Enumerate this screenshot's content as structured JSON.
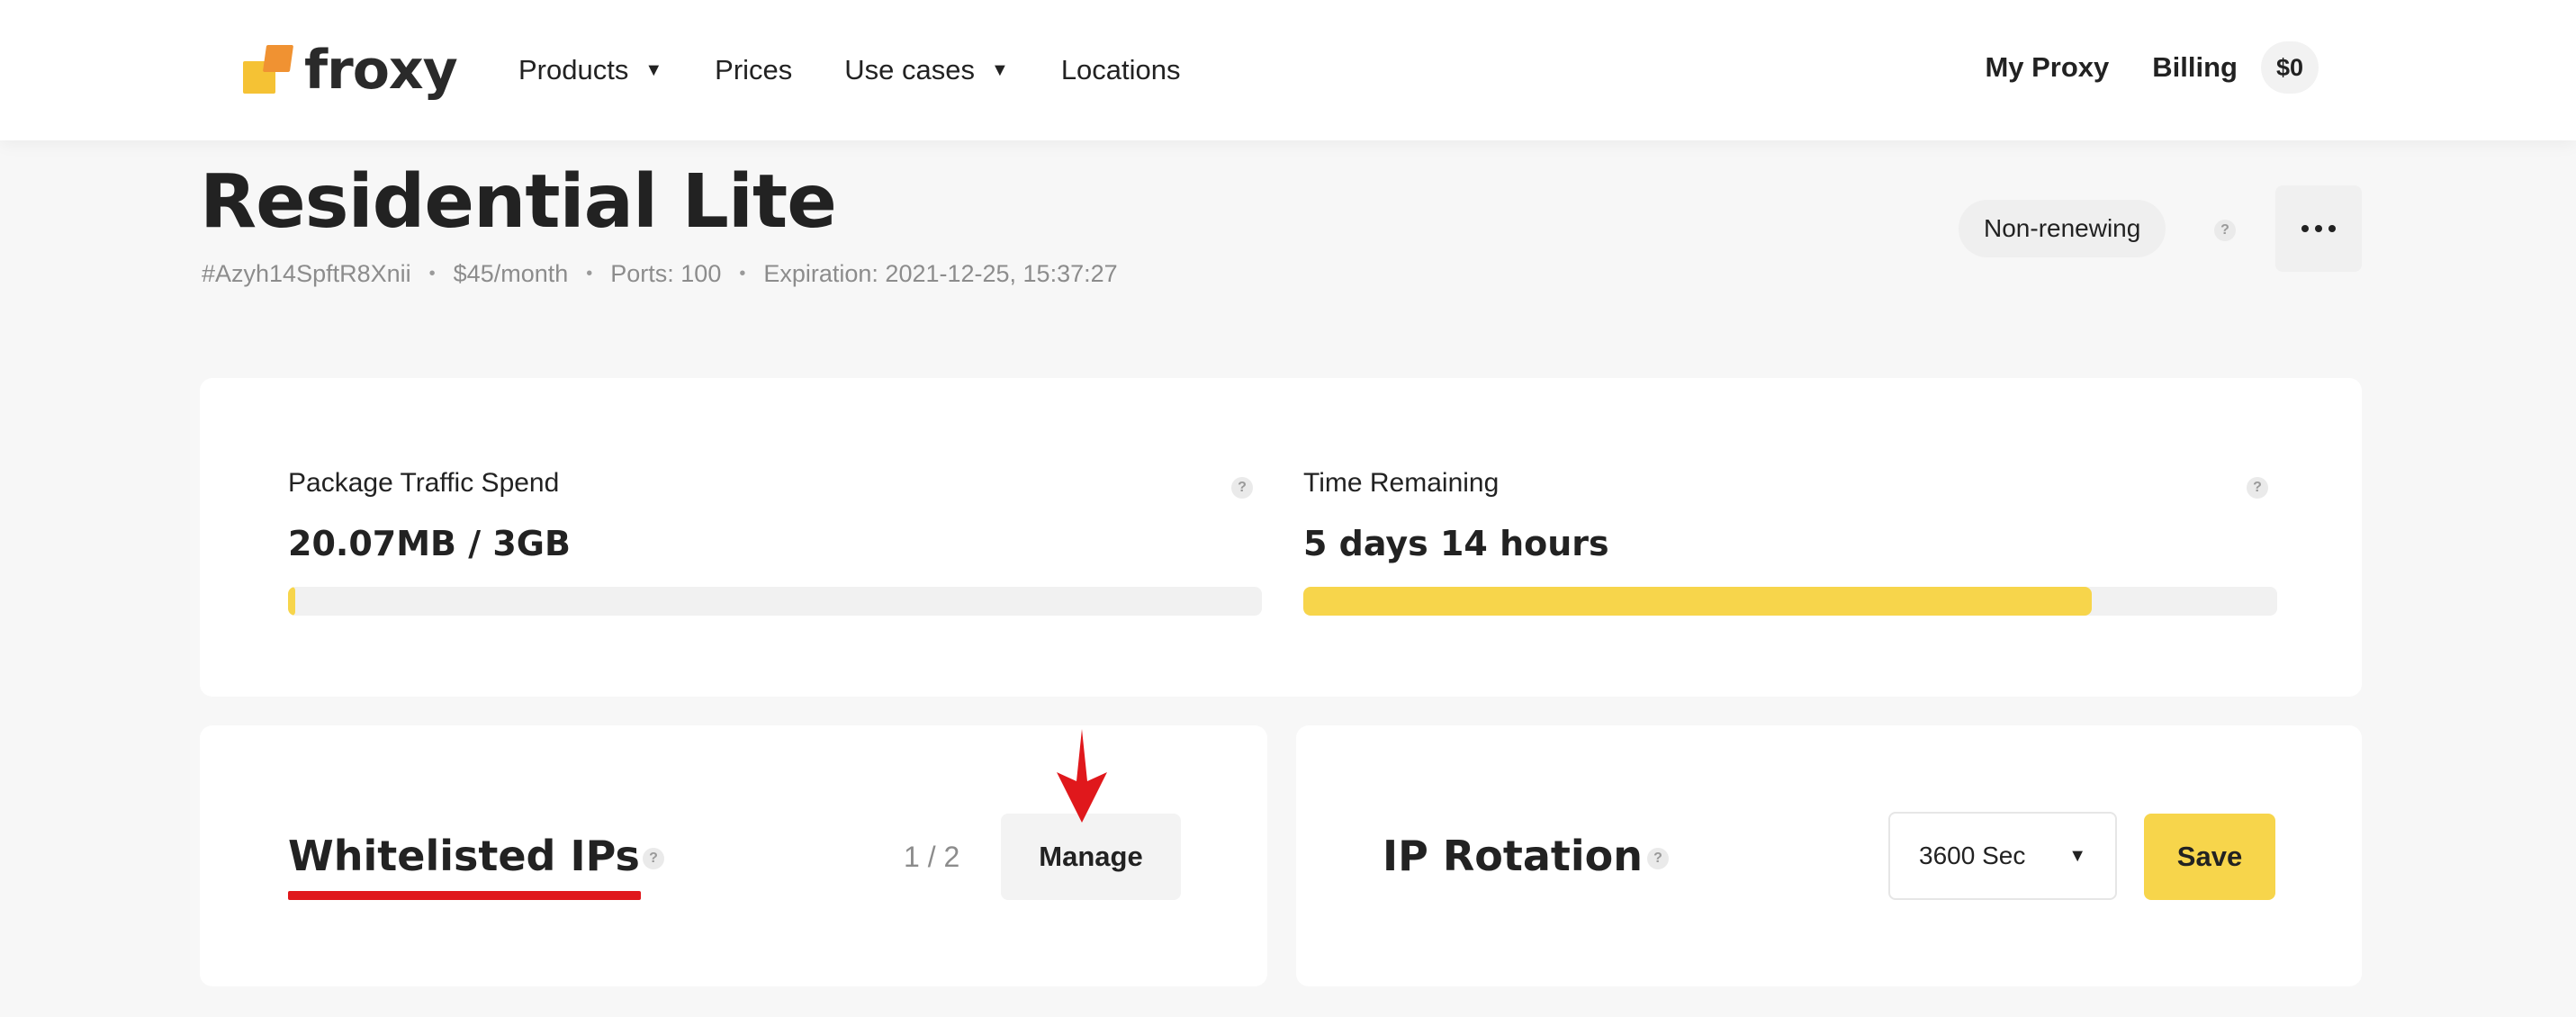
{
  "brand": {
    "name": "froxy"
  },
  "nav": {
    "items": [
      {
        "label": "Products",
        "has_dropdown": true
      },
      {
        "label": "Prices",
        "has_dropdown": false
      },
      {
        "label": "Use cases",
        "has_dropdown": true
      },
      {
        "label": "Locations",
        "has_dropdown": false
      }
    ]
  },
  "header_right": {
    "my_proxy": "My Proxy",
    "billing": "Billing",
    "balance": "$0"
  },
  "plan": {
    "title": "Residential Lite",
    "id": "#Azyh14SpftR8Xnii",
    "price": "$45/month",
    "ports": "Ports: 100",
    "expiration": "Expiration: 2021-12-25, 15:37:27",
    "renewal_status": "Non-renewing"
  },
  "stats": {
    "traffic": {
      "label": "Package Traffic Spend",
      "value": "20.07MB / 3GB",
      "progress_percent": 0.7
    },
    "time": {
      "label": "Time Remaining",
      "value": "5 days 14 hours",
      "progress_percent": 81
    }
  },
  "whitelist": {
    "title": "Whitelisted IPs",
    "count": "1 / 2",
    "manage_label": "Manage"
  },
  "rotation": {
    "title": "IP Rotation",
    "selected": "3600 Sec",
    "save_label": "Save"
  },
  "help_glyph": "?",
  "dropdown_glyph": "▼",
  "colors": {
    "accent_yellow": "#f7d54b",
    "logo_orange": "#f09232",
    "logo_yellow": "#f5c234",
    "annotation_red": "#e0181c"
  },
  "icons": [
    "froxy-logo-icon",
    "chevron-down-icon",
    "help-icon",
    "more-dots-icon",
    "red-arrow-annotation-icon"
  ]
}
